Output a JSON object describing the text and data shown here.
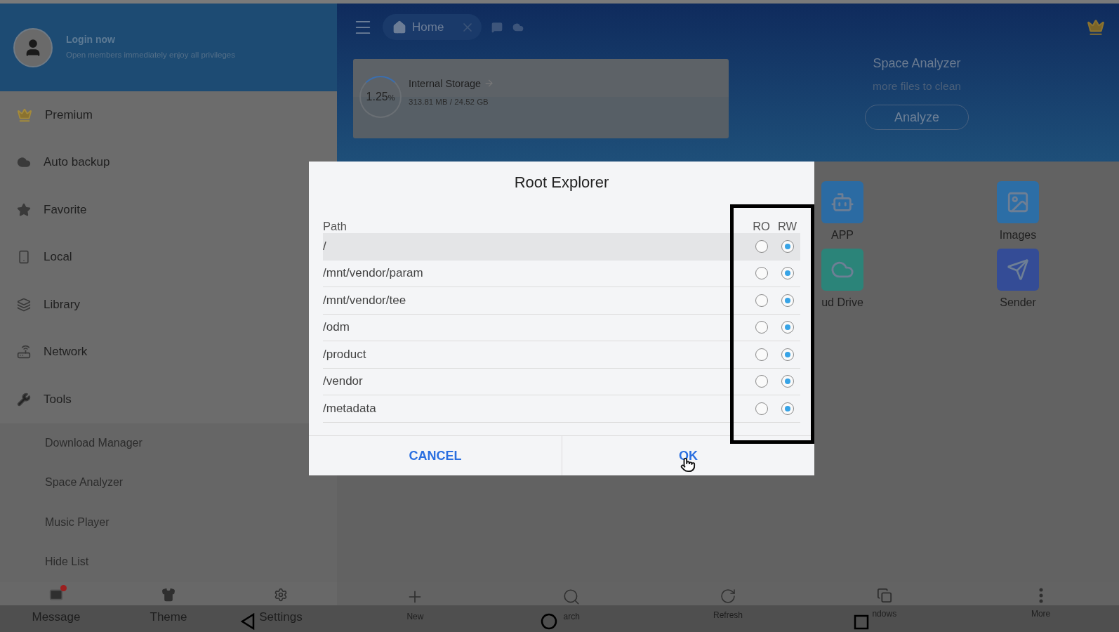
{
  "drawer": {
    "login": {
      "title": "Login now",
      "subtitle": "Open members immediately enjoy all privileges"
    },
    "items": [
      {
        "label": "Premium"
      },
      {
        "label": "Auto backup"
      },
      {
        "label": "Favorite"
      },
      {
        "label": "Local"
      },
      {
        "label": "Library"
      },
      {
        "label": "Network"
      },
      {
        "label": "Tools",
        "children": [
          {
            "label": "Download Manager"
          },
          {
            "label": "Space Analyzer"
          },
          {
            "label": "Music Player"
          },
          {
            "label": "Hide List"
          }
        ]
      }
    ],
    "bottom_bar": [
      {
        "label": "Message",
        "unread": true
      },
      {
        "label": "Theme",
        "unread": false
      },
      {
        "label": "Settings",
        "unread": false
      }
    ]
  },
  "toolbar": {
    "tabs": [
      {
        "label": "Home",
        "selected": true
      }
    ]
  },
  "storage_card": {
    "title": "Internal Storage",
    "percent": "1.25",
    "unit": "%",
    "level": 0.0125,
    "usage": "313.81 MB / 24.52 GB"
  },
  "space_analyzer": {
    "title": "Space Analyzer",
    "subtitle": "more files to clean",
    "button": "Analyze"
  },
  "shortcuts": [
    {
      "label": "APP",
      "color": "#2b6ba3"
    },
    {
      "label": "Images",
      "color": "#2c6ea6"
    },
    {
      "label": "ud Drive",
      "color": "#2b8479"
    },
    {
      "label": "Sender",
      "color": "#344c96"
    }
  ],
  "main_bar": [
    {
      "label": "New"
    },
    {
      "label": "arch"
    },
    {
      "label": "Refresh"
    },
    {
      "label": "ndows"
    },
    {
      "label": "More"
    }
  ],
  "dialog": {
    "title": "Root Explorer",
    "columns": [
      "Path",
      "RO",
      "RW"
    ],
    "rows": [
      {
        "path": "/",
        "highlighted": true,
        "ro_selected": false,
        "rw_selected": true
      },
      {
        "path": "/mnt/vendor/param",
        "highlighted": false,
        "ro_selected": false,
        "rw_selected": true
      },
      {
        "path": "/mnt/vendor/tee",
        "highlighted": false,
        "ro_selected": false,
        "rw_selected": true
      },
      {
        "path": "/odm",
        "highlighted": false,
        "ro_selected": false,
        "rw_selected": true
      },
      {
        "path": "/product",
        "highlighted": false,
        "ro_selected": false,
        "rw_selected": true
      },
      {
        "path": "/vendor",
        "highlighted": false,
        "ro_selected": false,
        "rw_selected": true
      },
      {
        "path": "/metadata",
        "highlighted": false,
        "ro_selected": false,
        "rw_selected": true
      }
    ],
    "buttons": [
      "CANCEL",
      "OK"
    ]
  }
}
